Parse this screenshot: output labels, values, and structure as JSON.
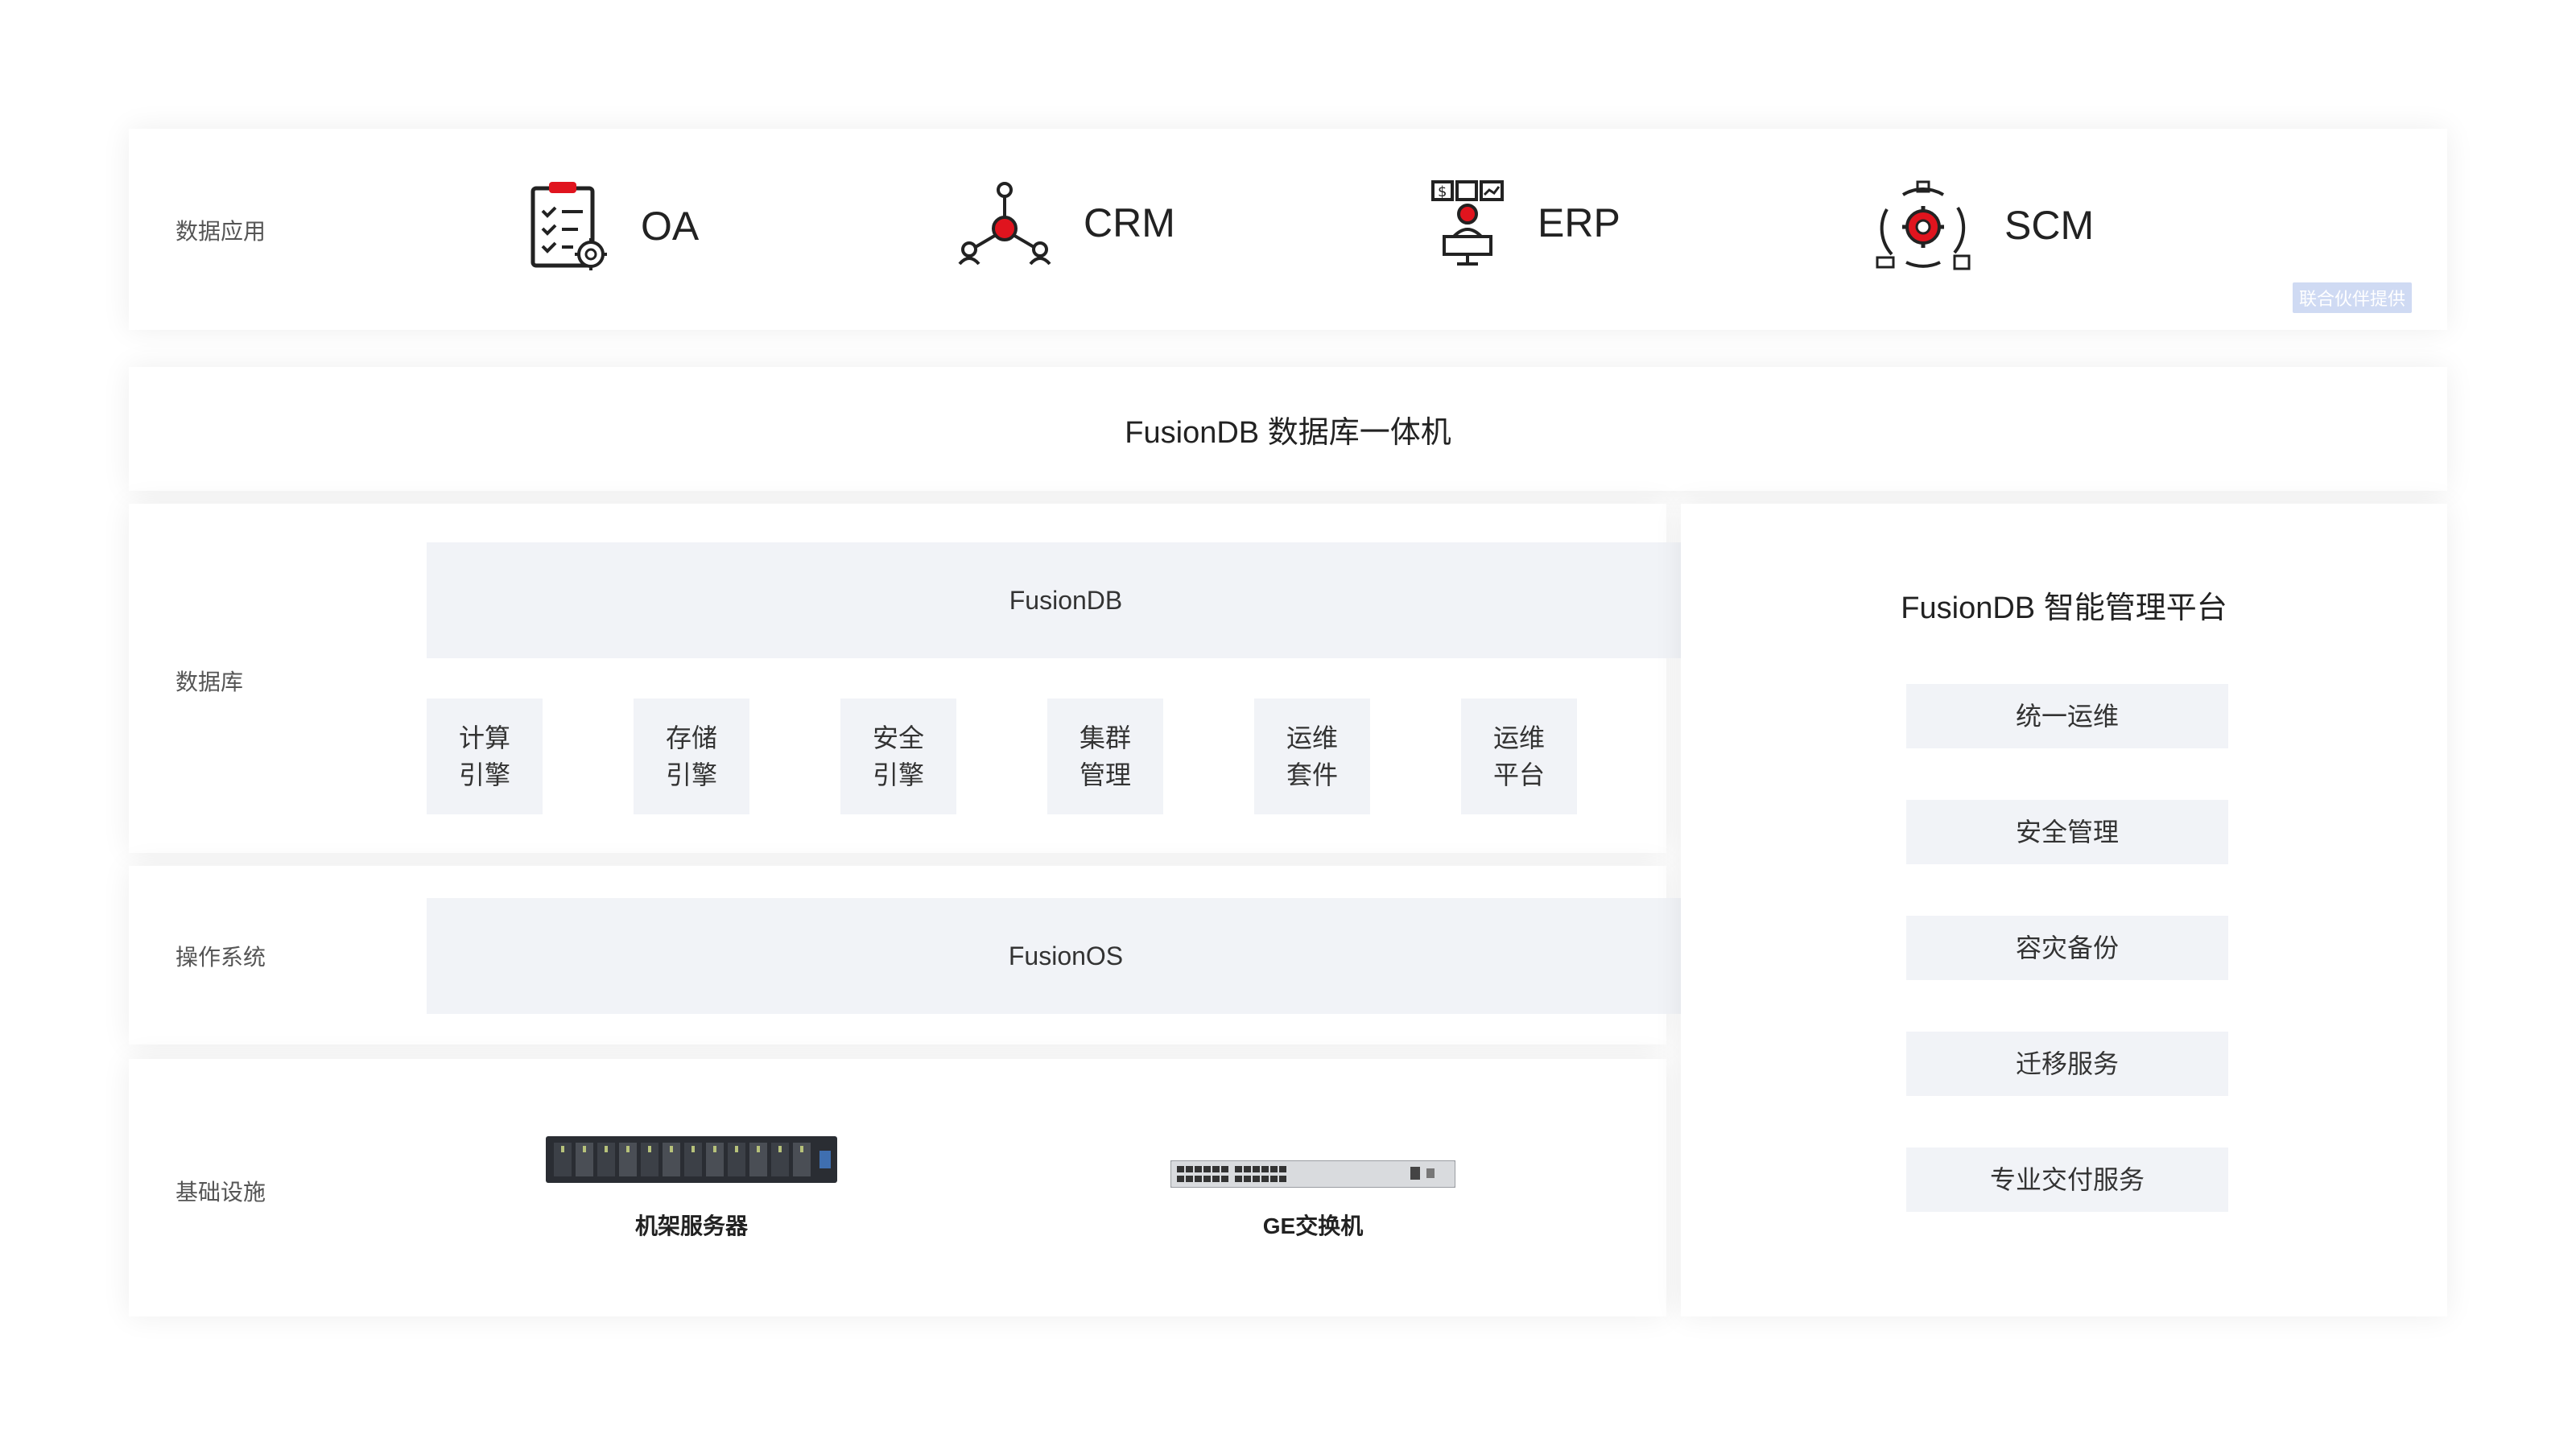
{
  "layers": {
    "data_apps": "数据应用",
    "database": "数据库",
    "os": "操作系统",
    "infra": "基础设施"
  },
  "apps": [
    {
      "name": "OA",
      "icon": "clipboard-gear-icon"
    },
    {
      "name": "CRM",
      "icon": "network-hub-icon"
    },
    {
      "name": "ERP",
      "icon": "finance-desk-icon"
    },
    {
      "name": "SCM",
      "icon": "supply-cycle-icon"
    }
  ],
  "partner_badge": "联合伙伴提供",
  "appliance_title": "FusionDB 数据库一体机",
  "database": {
    "title": "FusionDB",
    "modules": [
      "计算\n引擎",
      "存储\n引擎",
      "安全\n引擎",
      "集群\n管理",
      "运维\n套件",
      "运维\n平台"
    ]
  },
  "os": {
    "title": "FusionOS"
  },
  "infra": {
    "items": [
      {
        "label": "机架服务器",
        "icon": "rack-server-icon"
      },
      {
        "label": "GE交换机",
        "icon": "network-switch-icon"
      }
    ]
  },
  "management": {
    "title": "FusionDB 智能管理平台",
    "items": [
      "统一运维",
      "安全管理",
      "容灾备份",
      "迁移服务",
      "专业交付服务"
    ]
  },
  "colors": {
    "accent_red": "#e0141e",
    "block_bg": "#f1f3f7",
    "badge_bg": "#cfdaf3"
  }
}
